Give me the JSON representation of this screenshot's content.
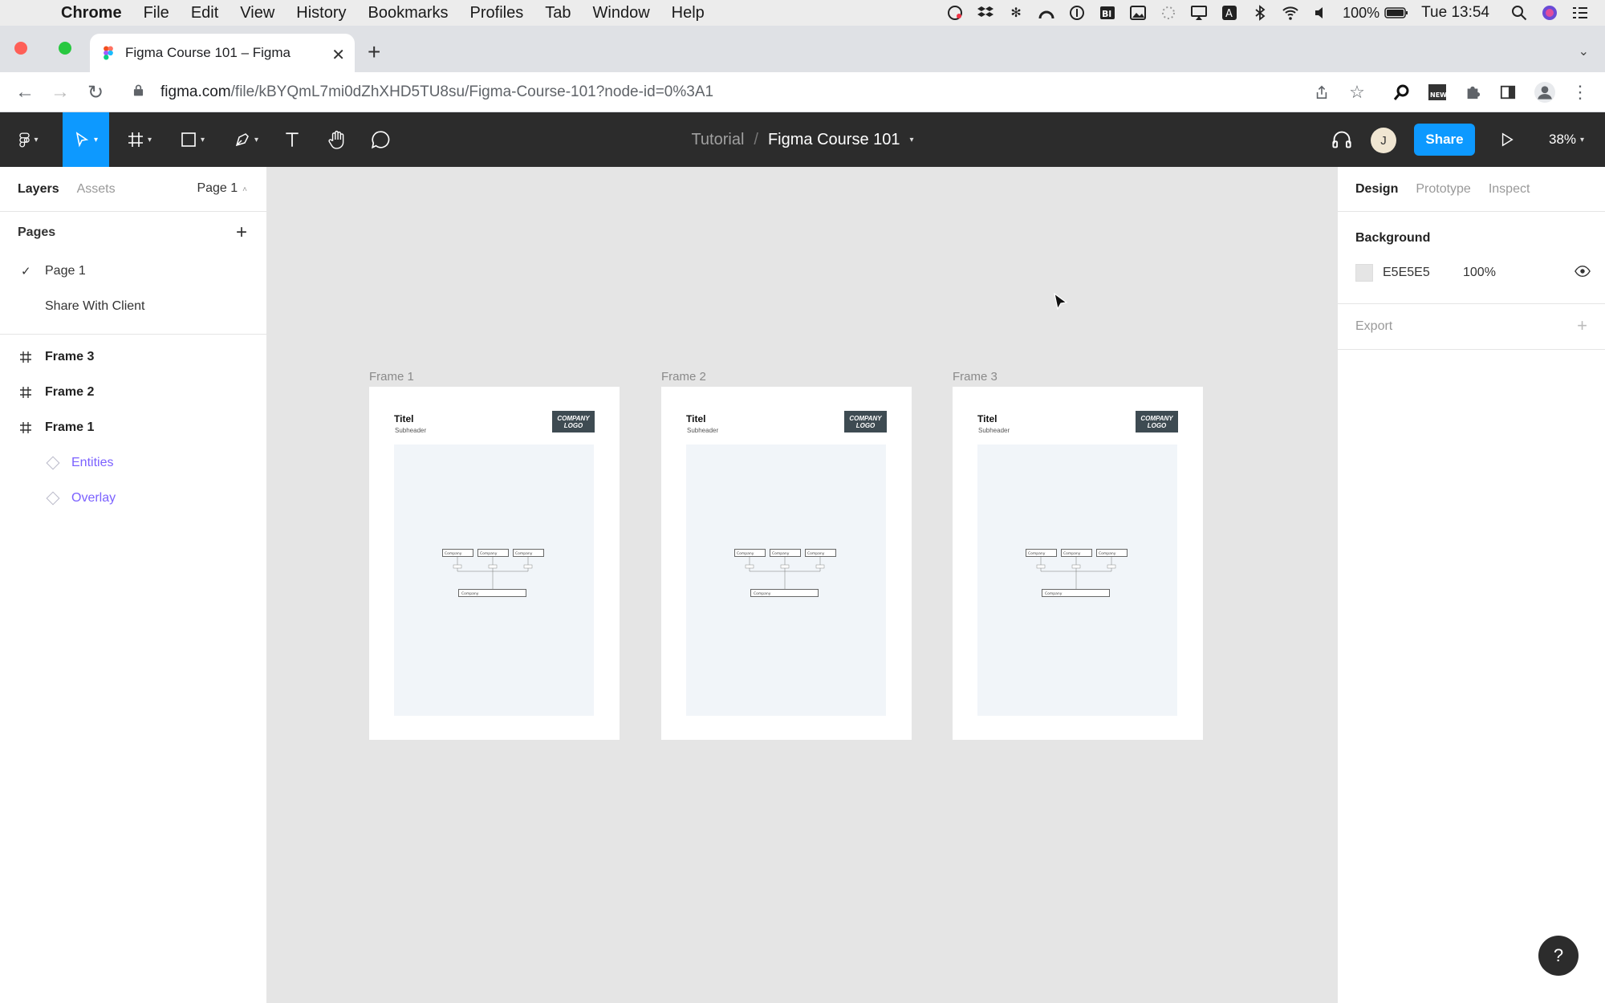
{
  "menubar": {
    "app": "Chrome",
    "items": [
      "File",
      "Edit",
      "View",
      "History",
      "Bookmarks",
      "Profiles",
      "Tab",
      "Window",
      "Help"
    ],
    "battery": "100%",
    "clock": "Tue 13:54"
  },
  "browser": {
    "tab_title": "Figma Course 101 – Figma",
    "url_host": "figma.com",
    "url_path": "/file/kBYQmL7mi0dZhXHD5TU8su/Figma-Course-101?node-id=0%3A1"
  },
  "figma_toolbar": {
    "project": "Tutorial",
    "separator": "/",
    "file_name": "Figma Course 101",
    "avatar_initial": "J",
    "share_label": "Share",
    "zoom": "38%"
  },
  "left_panel": {
    "tab_layers": "Layers",
    "tab_assets": "Assets",
    "page_selector": "Page 1",
    "pages_heading": "Pages",
    "pages": [
      "Page 1",
      "Share With Client"
    ],
    "layers": [
      "Frame 3",
      "Frame 2",
      "Frame 1"
    ],
    "components": [
      "Entities",
      "Overlay"
    ]
  },
  "canvas": {
    "frames": [
      {
        "label": "Frame 1",
        "title": "Titel",
        "subheader": "Subheader",
        "logo": "COMPANY LOGO"
      },
      {
        "label": "Frame 2",
        "title": "Titel",
        "subheader": "Subheader",
        "logo": "COMPANY LOGO"
      },
      {
        "label": "Frame 3",
        "title": "Titel",
        "subheader": "Subheader",
        "logo": "COMPANY LOGO"
      }
    ],
    "diagram_box_label": "Company"
  },
  "right_panel": {
    "tabs": [
      "Design",
      "Prototype",
      "Inspect"
    ],
    "background_heading": "Background",
    "background_hex": "E5E5E5",
    "background_opacity": "100%",
    "export_label": "Export"
  },
  "help_label": "?"
}
